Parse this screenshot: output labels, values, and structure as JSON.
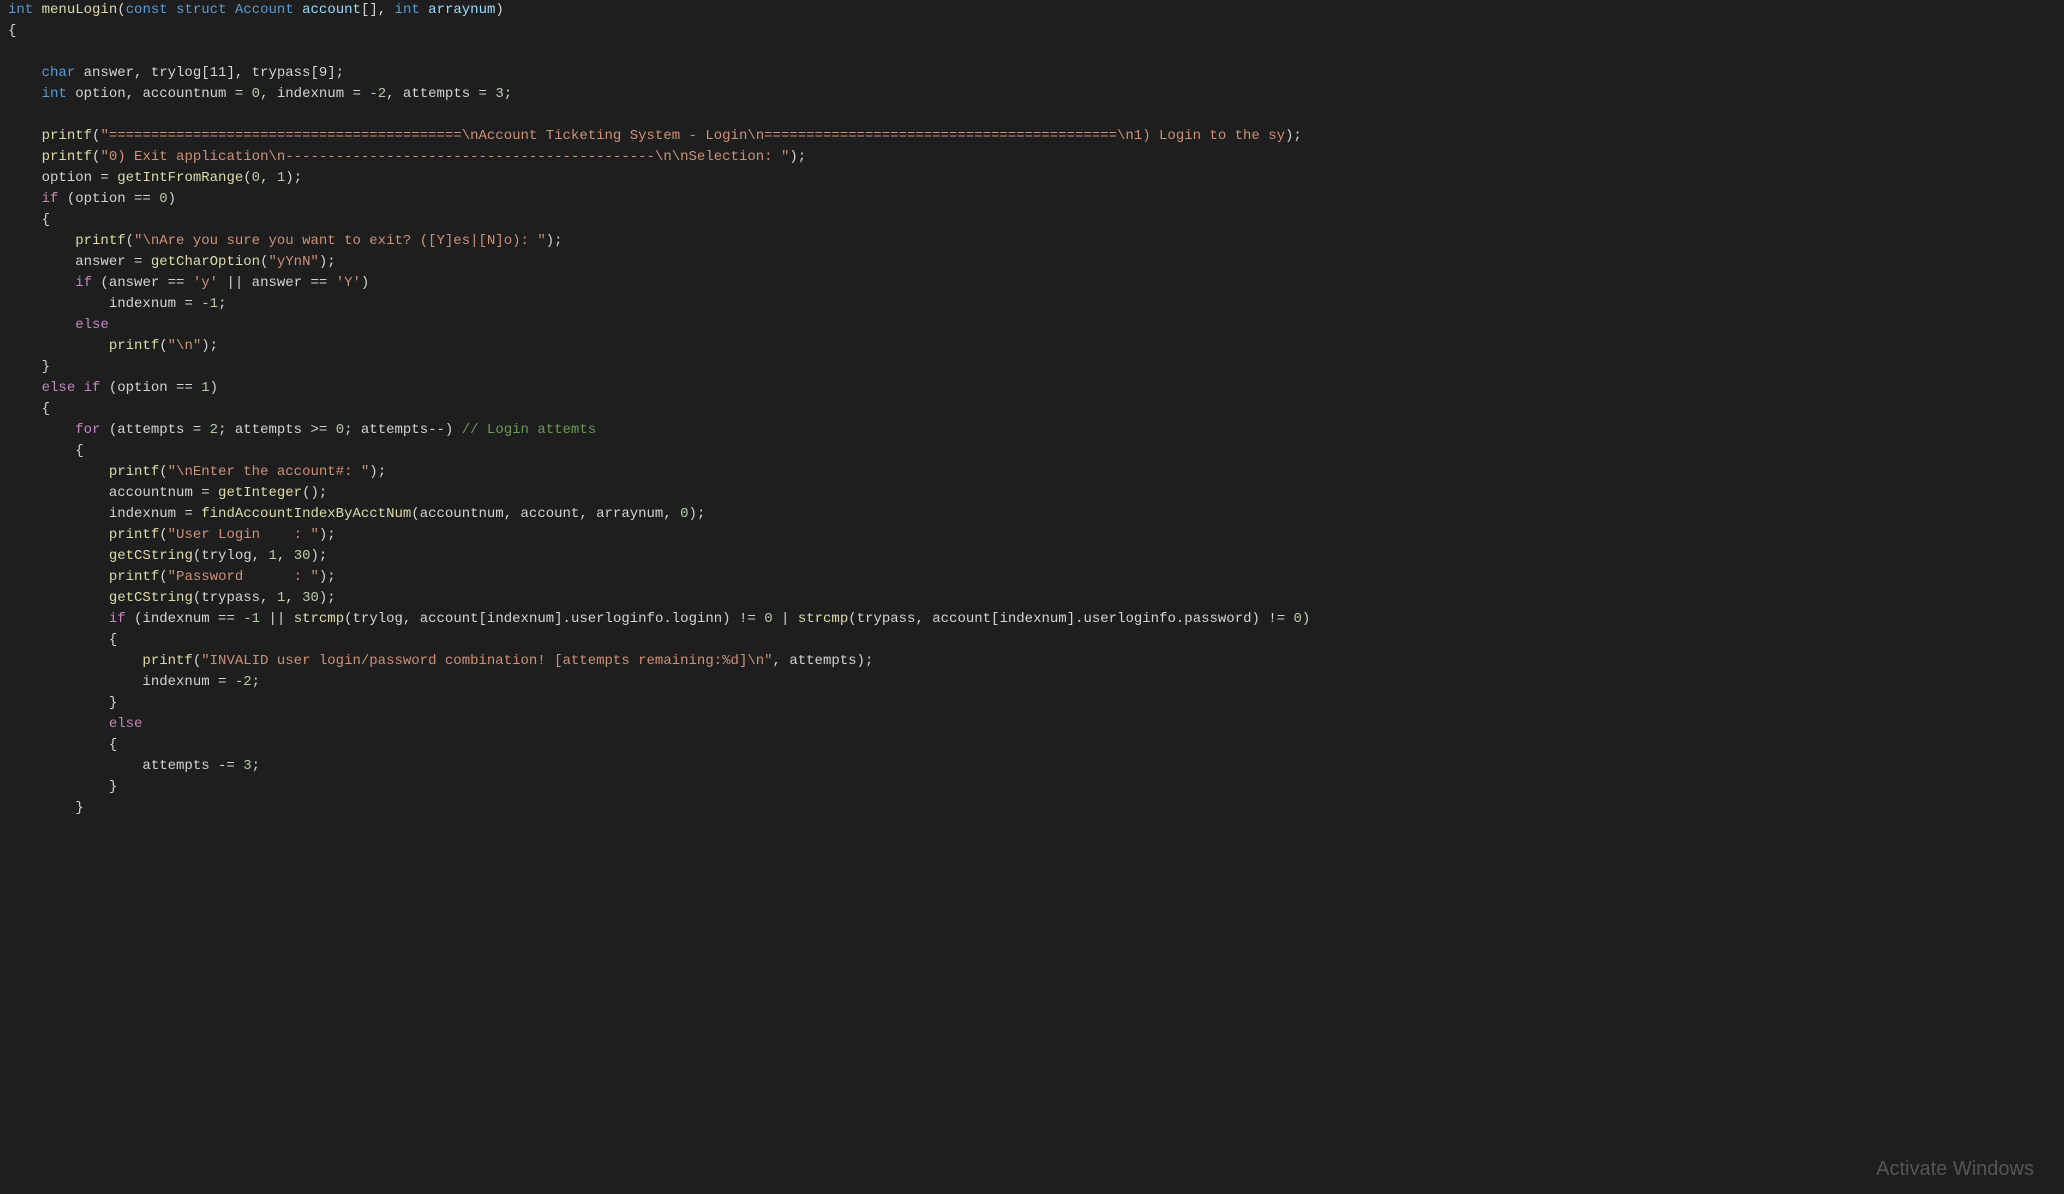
{
  "code": {
    "lines": [
      {
        "indent": 0,
        "content": "int menuLogin(const struct Account account[], int arraynum)"
      },
      {
        "indent": 0,
        "content": "{"
      },
      {
        "indent": 0,
        "content": ""
      },
      {
        "indent": 1,
        "content": "char answer, trylog[11], trypass[9];"
      },
      {
        "indent": 1,
        "content": "int option, accountnum = 0, indexnum = -2, attempts = 3;"
      },
      {
        "indent": 0,
        "content": ""
      },
      {
        "indent": 1,
        "content": "printf(\"==========================================\\nAccount Ticketing System - Login\\n==========================================\\n1) Login to the sy"
      },
      {
        "indent": 1,
        "content": "printf(\"0) Exit application\\n--------------------------------------------\\n\\nSelection: \");"
      },
      {
        "indent": 1,
        "content": "option = getIntFromRange(0, 1);"
      },
      {
        "indent": 1,
        "content": "if (option == 0)"
      },
      {
        "indent": 1,
        "content": "{"
      },
      {
        "indent": 2,
        "content": "printf(\"\\nAre you sure you want to exit? ([Y]es|[N]o): \");"
      },
      {
        "indent": 2,
        "content": "answer = getCharOption(\"yYnN\");"
      },
      {
        "indent": 2,
        "content": "if (answer == 'y' || answer == 'Y')"
      },
      {
        "indent": 3,
        "content": "indexnum = -1;"
      },
      {
        "indent": 2,
        "content": "else"
      },
      {
        "indent": 3,
        "content": "printf(\"\\n\");"
      },
      {
        "indent": 1,
        "content": "}"
      },
      {
        "indent": 1,
        "content": "else if (option == 1)"
      },
      {
        "indent": 1,
        "content": "{"
      },
      {
        "indent": 2,
        "content": "for (attempts = 2; attempts >= 0; attempts--) // Login attemts"
      },
      {
        "indent": 2,
        "content": "{"
      },
      {
        "indent": 3,
        "content": "printf(\"\\nEnter the account#: \");"
      },
      {
        "indent": 3,
        "content": "accountnum = getInteger();"
      },
      {
        "indent": 3,
        "content": "indexnum = findAccountIndexByAcctNum(accountnum, account, arraynum, 0);"
      },
      {
        "indent": 3,
        "content": "printf(\"User Login    : \");"
      },
      {
        "indent": 3,
        "content": "getCString(trylog, 1, 30);"
      },
      {
        "indent": 3,
        "content": "printf(\"Password      : \");"
      },
      {
        "indent": 3,
        "content": "getCString(trypass, 1, 30);"
      },
      {
        "indent": 3,
        "content": "if (indexnum == -1 || strcmp(trylog, account[indexnum].userloginfo.loginn) != 0 | strcmp(trypass, account[indexnum].userloginfo.password) != 0)"
      },
      {
        "indent": 3,
        "content": "{"
      },
      {
        "indent": 4,
        "content": "printf(\"INVALID user login/password combination! [attempts remaining:%d]\\n\", attempts);"
      },
      {
        "indent": 4,
        "content": "indexnum = -2;"
      },
      {
        "indent": 3,
        "content": "}"
      },
      {
        "indent": 3,
        "content": "else"
      },
      {
        "indent": 3,
        "content": "{"
      },
      {
        "indent": 4,
        "content": "attempts -= 3;"
      },
      {
        "indent": 3,
        "content": "}"
      },
      {
        "indent": 2,
        "content": "}"
      }
    ]
  },
  "watermark": "Activate Wind"
}
